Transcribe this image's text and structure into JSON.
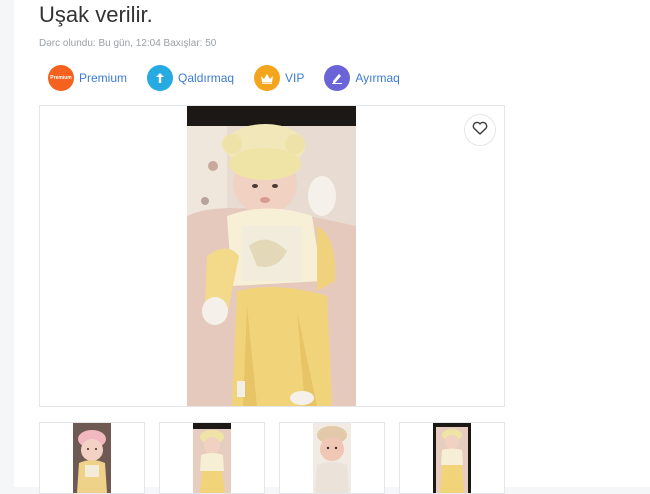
{
  "listing": {
    "title": "Uşak verilir.",
    "meta": "Dərc olundu: Bu gün, 12:04 Baxışlar: 50"
  },
  "actions": [
    {
      "label": "Premium",
      "badge": "Premium",
      "icon": "premium-badge-icon",
      "color": "#f5611e"
    },
    {
      "label": "Qaldırmaq",
      "icon": "arrow-up-icon",
      "color": "#27a9e1"
    },
    {
      "label": "VIP",
      "icon": "crown-icon",
      "color": "#f3a51e"
    },
    {
      "label": "Ayırmaq",
      "icon": "pencil-icon",
      "color": "#6a64d8"
    }
  ],
  "gallery": {
    "favorite_icon": "heart-icon",
    "thumbnails": [
      {
        "name": "baby-pink-hat"
      },
      {
        "name": "baby-yellow-outfit"
      },
      {
        "name": "baby-beige-hat"
      },
      {
        "name": "baby-yellow-outfit-full"
      }
    ]
  }
}
